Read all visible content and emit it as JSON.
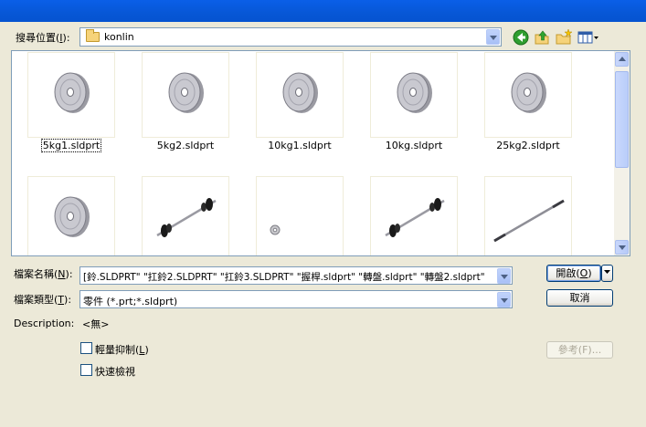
{
  "look_in": {
    "label_prefix": "搜尋位置(",
    "label_key": "I",
    "label_suffix": "):",
    "value": "konlin"
  },
  "toolbar": {
    "icons": [
      "back-icon",
      "up-folder-icon",
      "new-folder-icon",
      "view-menu-icon"
    ]
  },
  "files": [
    {
      "name": "5kg1.sldprt",
      "thumb": "plate",
      "selected": true
    },
    {
      "name": "5kg2.sldprt",
      "thumb": "plate"
    },
    {
      "name": "10kg1.sldprt",
      "thumb": "plate"
    },
    {
      "name": "10kg.sldprt",
      "thumb": "plate"
    },
    {
      "name": "25kg2.sldprt",
      "thumb": "plate"
    },
    {
      "name": "",
      "thumb": "plate"
    },
    {
      "name": "",
      "thumb": "barbell"
    },
    {
      "name": "",
      "thumb": "collar"
    },
    {
      "name": "",
      "thumb": "barbell"
    },
    {
      "name": "",
      "thumb": "bar"
    }
  ],
  "filename": {
    "label_prefix": "檔案名稱(",
    "label_key": "N",
    "label_suffix": "):",
    "value": "[鈴.SLDPRT\" \"扛鈴2.SLDPRT\" \"扛鈴3.SLDPRT\" \"握桿.sldprt\" \"轉盤.sldprt\" \"轉盤2.sldprt\""
  },
  "filetype": {
    "label_prefix": "檔案類型(",
    "label_key": "T",
    "label_suffix": "):",
    "value": "零件 (*.prt;*.sldprt)"
  },
  "description": {
    "label": "Description:",
    "value": "<無>"
  },
  "options": {
    "lightweight_prefix": "輕量抑制(",
    "lightweight_key": "L",
    "lightweight_suffix": ")",
    "quick_view": "快速檢視"
  },
  "buttons": {
    "open_prefix": "開啟(",
    "open_key": "O",
    "open_suffix": ")",
    "cancel": "取消",
    "references": "參考(F)..."
  },
  "colors": {
    "titlebar": "#0553D0",
    "dialog_bg": "#ECE9D8",
    "border": "#7F9DB9"
  }
}
